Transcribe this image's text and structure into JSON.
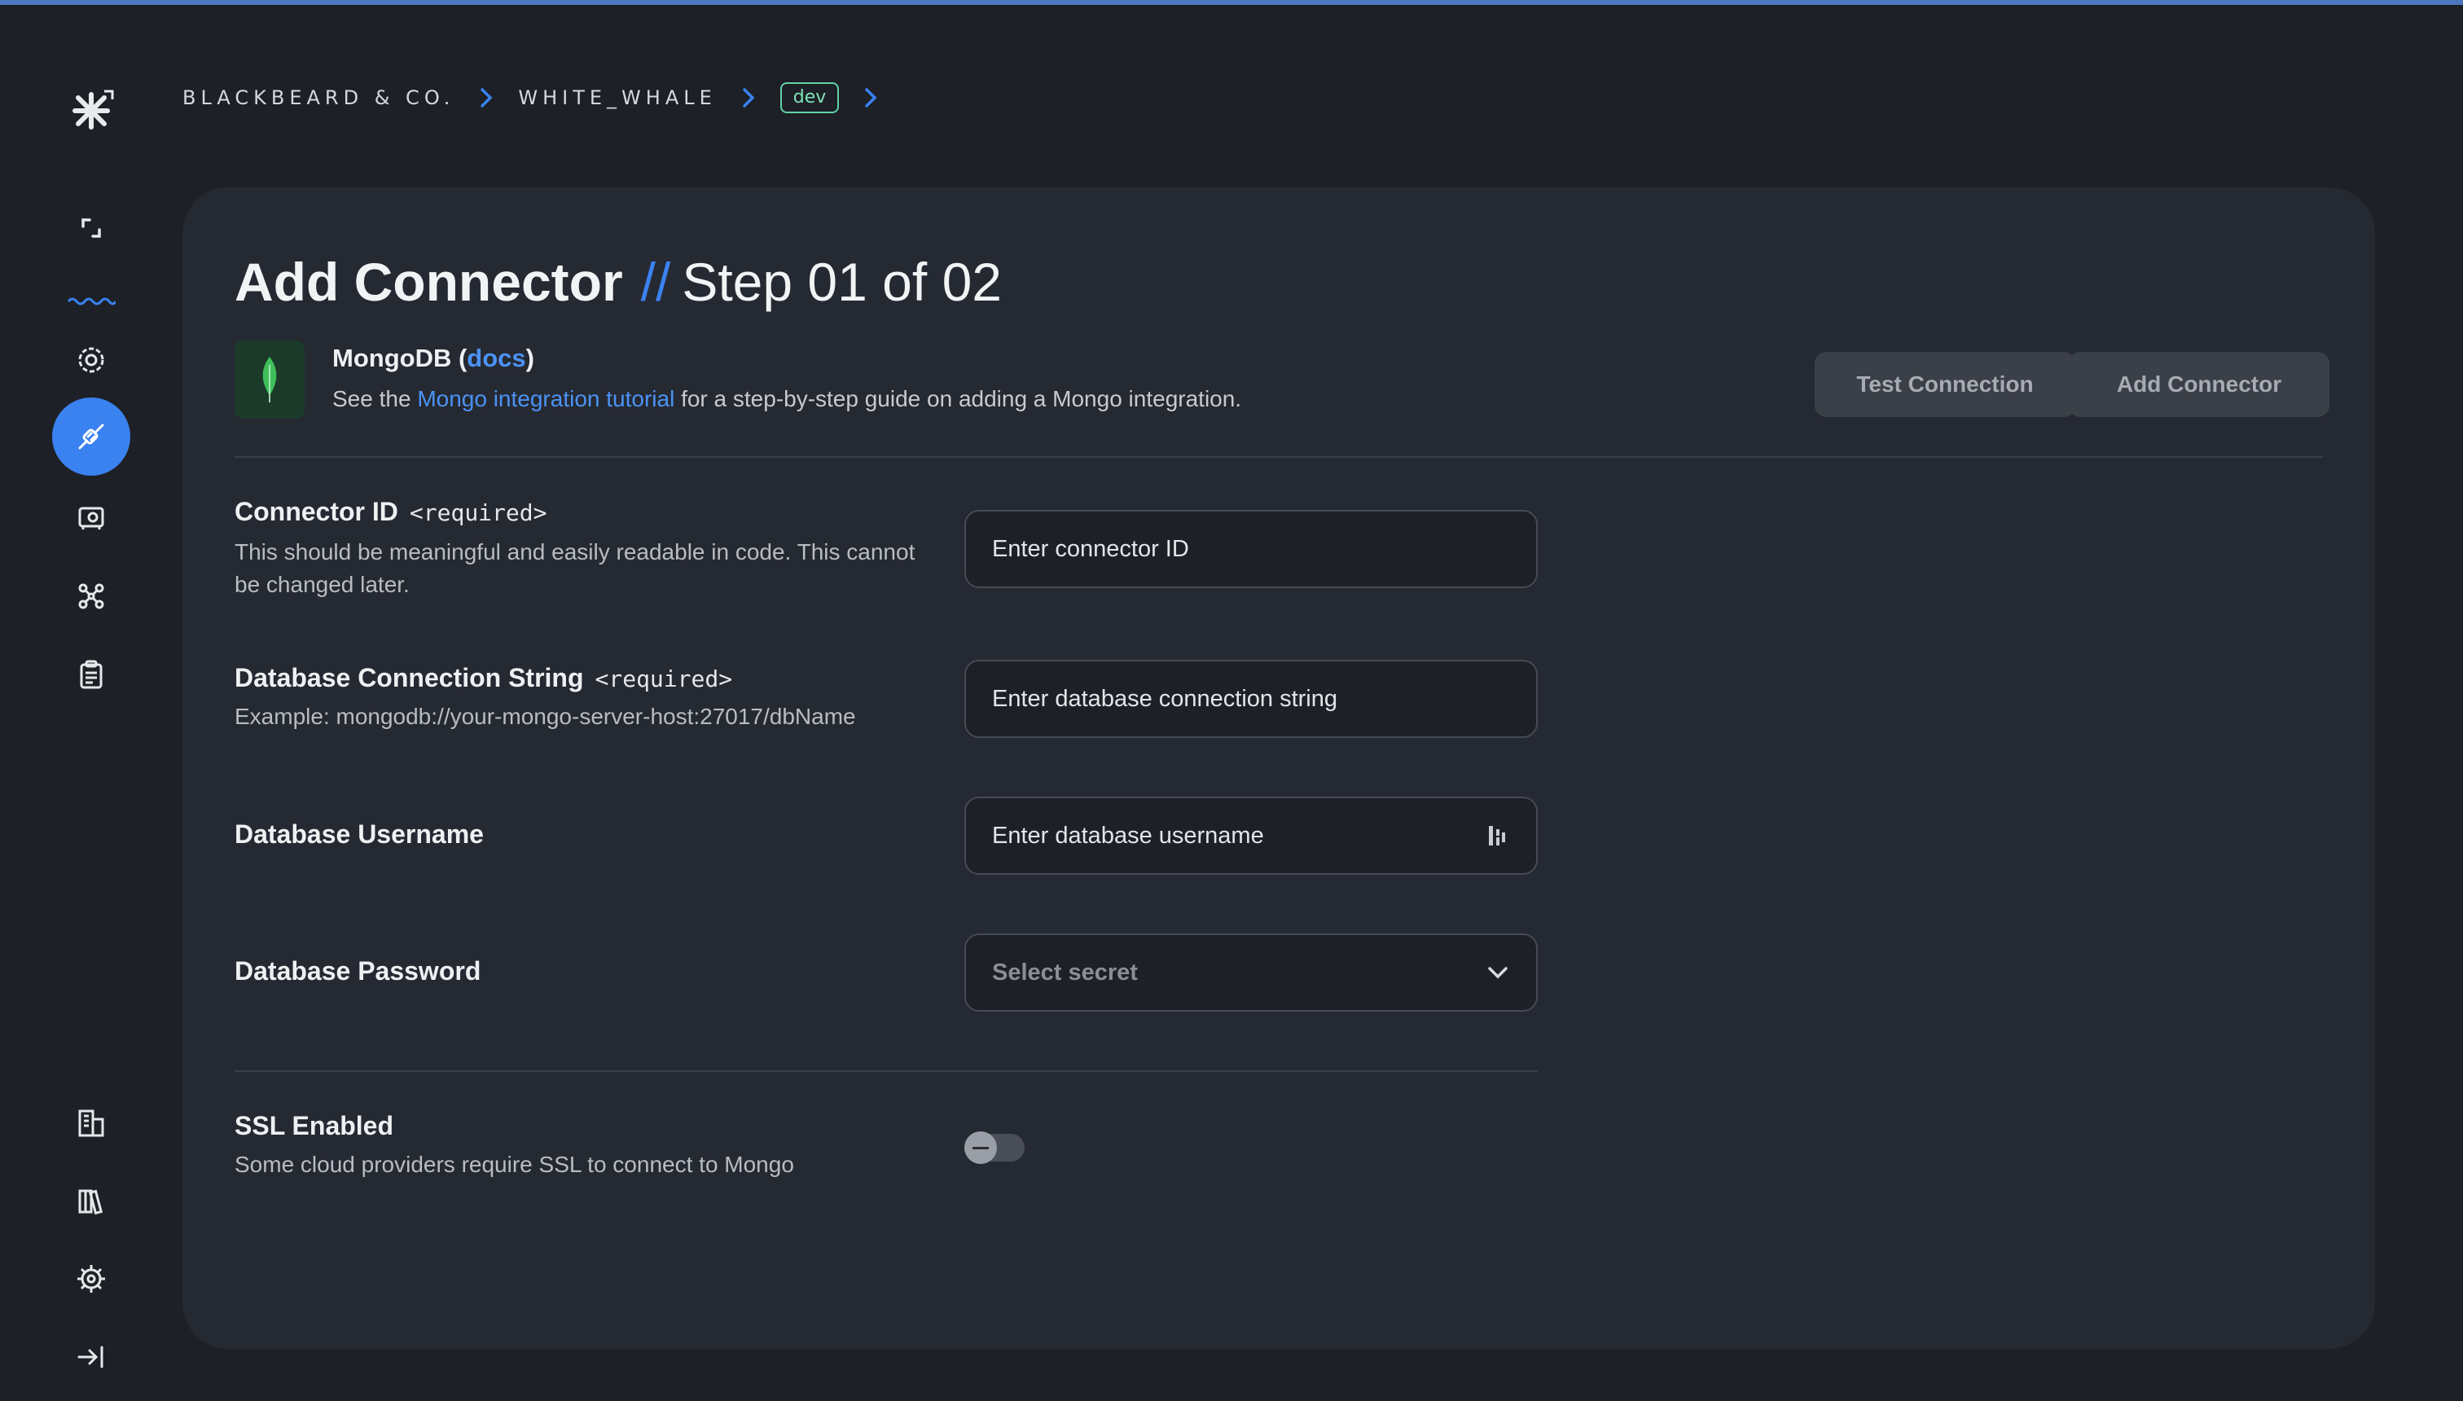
{
  "colors": {
    "background": "#1d2026",
    "card": "#252932",
    "accent": "#3a82f0",
    "link": "#4b93f5",
    "env_badge": "#5fd3a6",
    "mongo_green": "#3fbf5a"
  },
  "sidebar": {
    "logo_icon": "asterisk-logo-icon",
    "items": [
      {
        "name": "expand-icon",
        "active": false
      },
      {
        "name": "waves-icon",
        "active": false
      },
      {
        "name": "settings-gear-icon",
        "active": false
      },
      {
        "name": "connectors-plug-icon",
        "active": true
      },
      {
        "name": "vault-icon",
        "active": false
      },
      {
        "name": "graph-nodes-icon",
        "active": false
      },
      {
        "name": "clipboard-icon",
        "active": false
      },
      {
        "name": "building-icon",
        "active": false
      },
      {
        "name": "library-books-icon",
        "active": false
      },
      {
        "name": "helm-settings-icon",
        "active": false
      },
      {
        "name": "collapse-sidebar-icon",
        "active": false
      }
    ]
  },
  "breadcrumb": {
    "org": "BLACKBEARD & CO.",
    "project": "WHITE_WHALE",
    "environment": "dev"
  },
  "header": {
    "title": "Add Connector",
    "separator": "//",
    "step": "Step 01 of 02"
  },
  "connector": {
    "name": "MongoDB",
    "open_paren": " (",
    "docs_link": "docs",
    "close_paren": ")",
    "desc_prefix": "See the ",
    "tutorial_link": "Mongo integration tutorial",
    "desc_suffix": " for a step-by-step guide on adding a Mongo integration."
  },
  "actions": {
    "test_label": "Test Connection",
    "add_label": "Add Connector"
  },
  "fields": {
    "connector_id": {
      "label": "Connector ID",
      "required": "<required>",
      "help": "This should be meaningful and easily readable in code. This cannot be changed later.",
      "placeholder": "Enter connector ID",
      "value": ""
    },
    "connection_string": {
      "label": "Database Connection String",
      "required": "<required>",
      "help": "Example: mongodb://your-mongo-server-host:27017/dbName",
      "placeholder": "Enter database connection string",
      "value": ""
    },
    "username": {
      "label": "Database Username",
      "placeholder": "Enter database username",
      "value": ""
    },
    "password": {
      "label": "Database Password",
      "placeholder": "Select secret"
    },
    "ssl": {
      "label": "SSL Enabled",
      "help": "Some cloud providers require SSL to connect to Mongo",
      "enabled": false
    }
  }
}
